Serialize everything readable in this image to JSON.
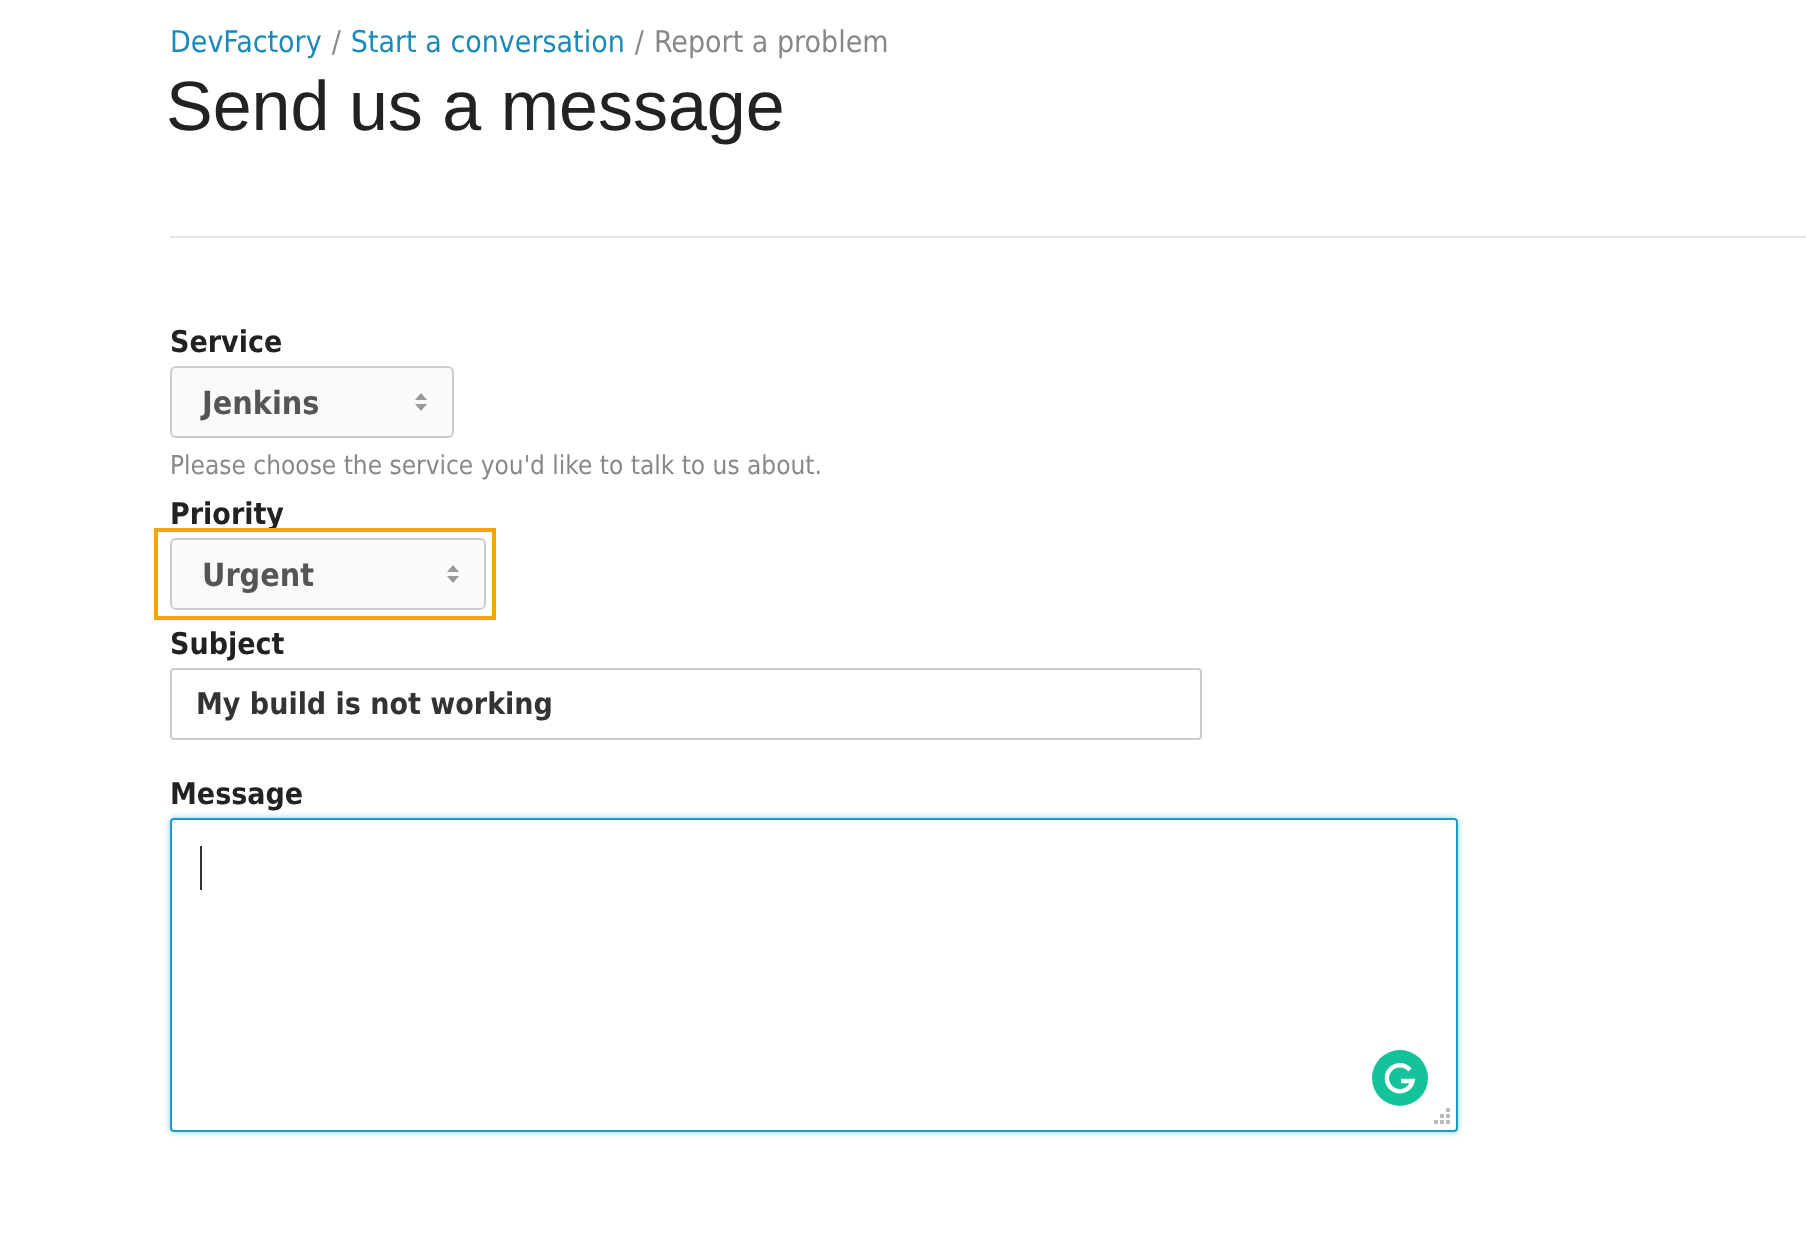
{
  "breadcrumb": {
    "separator": "/",
    "items": [
      {
        "label": "DevFactory",
        "current": false
      },
      {
        "label": "Start a conversation",
        "current": false
      },
      {
        "label": "Report a problem",
        "current": true
      }
    ]
  },
  "title": "Send us a message",
  "fields": [
    {
      "kind": "select",
      "label": "Service",
      "value": "Jenkins",
      "help": "Please choose the service you'd like to talk to us about.",
      "highlighted": false,
      "focused": false
    },
    {
      "kind": "select",
      "label": "Priority",
      "value": "Urgent",
      "highlighted": true,
      "focused": false
    },
    {
      "kind": "text",
      "label": "Subject",
      "value": "My build is not working",
      "highlighted": false,
      "focused": false
    },
    {
      "kind": "textarea",
      "label": "Message",
      "highlighted": false,
      "focused": true
    }
  ]
}
